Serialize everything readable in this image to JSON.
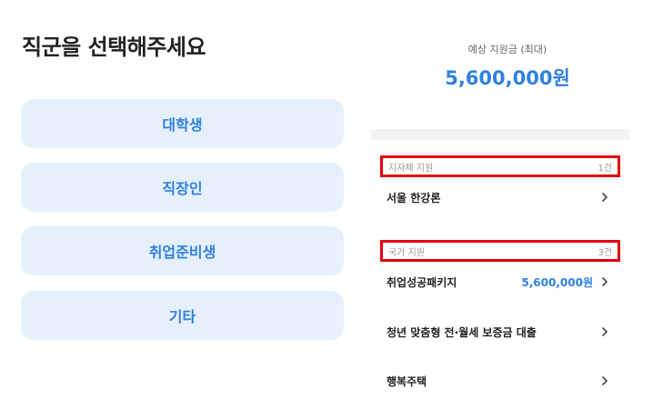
{
  "page_title": "직군을 선택해주세요",
  "job_options": [
    "대학생",
    "직장인",
    "취업준비생",
    "기타"
  ],
  "estimate": {
    "label": "예상 지원금 (최대)",
    "amount": "5,600,000원"
  },
  "sections": [
    {
      "title": "지자체 지원",
      "count": "1건",
      "items": [
        {
          "label": "서울 한강론",
          "amount": ""
        }
      ]
    },
    {
      "title": "국가 지원",
      "count": "3건",
      "items": [
        {
          "label": "취업성공패키지",
          "amount": "5,600,000원"
        },
        {
          "label": "청년 맞춤형 전·월세 보증금 대출",
          "amount": ""
        },
        {
          "label": "행복주택",
          "amount": ""
        }
      ]
    }
  ],
  "icons": {
    "chevron": "chevron-right-icon"
  },
  "colors": {
    "accent": "#2f80e0",
    "button_bg": "#e5f0fc",
    "highlight_border": "#e3000f"
  }
}
